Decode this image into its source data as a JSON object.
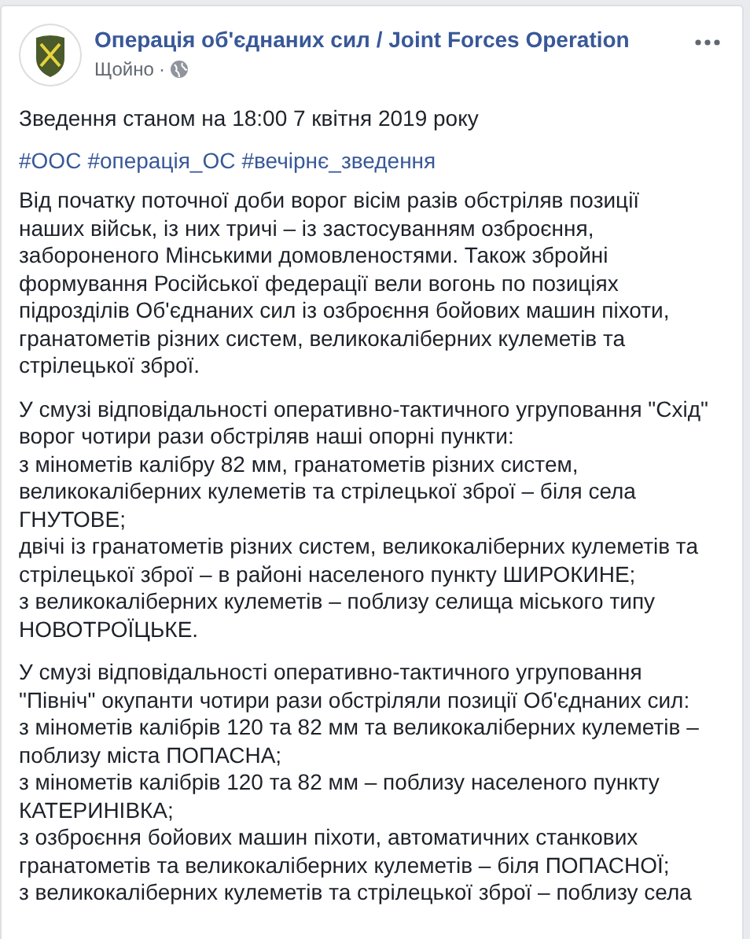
{
  "post": {
    "author": "Операція об'єднаних сил / Joint Forces Operation",
    "time": "Щойно",
    "separator": "·",
    "summary": "Зведення станом на 18:00 7 квітня 2019 року",
    "hashtags": [
      "#ООС",
      "#операція_ОС",
      "#вечірнє_зведення"
    ],
    "paragraphs": [
      {
        "lines": [
          "Від початку поточної доби ворог вісім разів обстріляв позиції наших військ, із них тричі – із застосуванням озброєння, забороненого Мінськими домовленостями. Також збройні формування Російської федерації вели вогонь по позиціях підрозділів Об'єднаних сил із озброєння бойових машин піхоти, гранатометів різних систем, великокаліберних кулеметів та стрілецької зброї."
        ]
      },
      {
        "lines": [
          "У смузі відповідальності оперативно-тактичного угруповання \"Схід\" ворог чотири рази обстріляв наші опорні пункти:",
          "з мінометів калібру 82 мм, гранатометів різних систем, великокаліберних кулеметів та стрілецької зброї – біля села ГНУТОВЕ;",
          "двічі із гранатометів різних систем, великокаліберних кулеметів та стрілецької зброї – в районі населеного пункту ШИРОКИНЕ;",
          "з великокаліберних кулеметів – поблизу селища міського типу НОВОТРОЇЦЬКЕ."
        ]
      },
      {
        "lines": [
          "У смузі відповідальності оперативно-тактичного угруповання \"Північ\" окупанти чотири рази обстріляли позиції Об'єднаних сил:",
          "з мінометів калібрів 120 та 82 мм та великокаліберних кулеметів – поблизу міста ПОПАСНА;",
          "з мінометів калібрів 120 та 82 мм – поблизу населеного пункту КАТЕРИНІВКА;",
          "з озброєння бойових машин піхоти, автоматичних станкових гранатометів та великокаліберних кулеметів – біля ПОПАСНОЇ;",
          "з великокаліберних кулеметів та стрілецької зброї – поблизу села"
        ]
      }
    ]
  }
}
